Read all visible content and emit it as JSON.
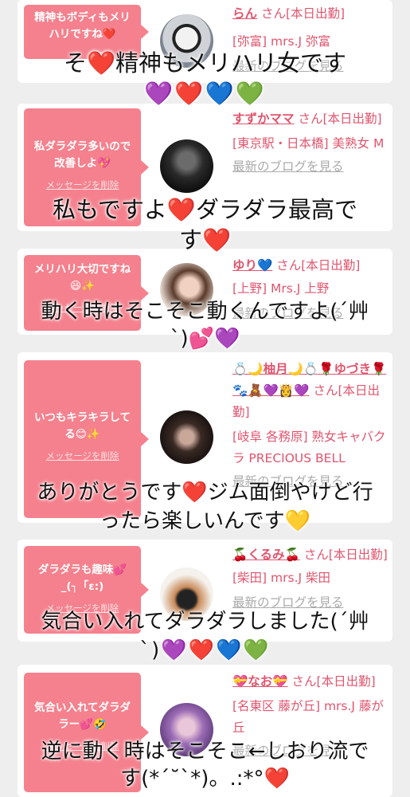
{
  "delete_label": "メッセージを削除",
  "blog_label": "最新のブログを見る",
  "cards": [
    {
      "message": "精神もボディもメリハリですね❤️",
      "name": "らん",
      "san": "さん[本日出勤]",
      "location": "[弥富] mrs.J 弥富",
      "overlay_line1": "そ❤️精神もメリハリ女です",
      "overlay_line2": "💜❤️💙💚"
    },
    {
      "message": "私ダラダラ多いので改善しよ💖",
      "name": "すずかママ",
      "san": "さん[本日出勤]",
      "location": "[東京駅・日本橋] 美熟女 M",
      "overlay_line1": "私もですよ❤️ダラダラ最高で",
      "overlay_line2": "す❤️"
    },
    {
      "message": "メリハリ大切ですね😆✨",
      "name": "ゆり💙",
      "san": "さん[本日出勤]",
      "location": "[上野] Mrs.J 上野",
      "overlay_line1": "動く時はそこそこ動くんですよ(´艸",
      "overlay_line2": "`)💕💜"
    },
    {
      "message": "いつもキラキラしてる😊✨",
      "name": "💍🌙柚月🌙💍🌹ゆづき🌹🐾🧸💜👸💜",
      "san": "さん[本日出勤]",
      "location": "[岐阜 各務原] 熟女キャバクラ PRECIOUS BELL",
      "overlay_line1": "ありがとうです❤️ジム面倒やけど行",
      "overlay_line2": "ったら楽しいんです💛"
    },
    {
      "message": "ダラダラも趣味💕_(┐「ε:)",
      "name": "🍒くるみ🍒",
      "san": "さん[本日出勤]",
      "location": "[柴田] mrs.J 柴田",
      "overlay_line1": "気合い入れてダラダラしました(´艸",
      "overlay_line2": "`)💜❤️💙💚"
    },
    {
      "message": "気合い入れてダラダラー💕🤣",
      "name": "💝なお💝",
      "san": "さん[本日出勤]",
      "location": "[名東区 藤が丘] mrs.J 藤が丘",
      "overlay_line1": "逆に動く時はそこそこ←しおり流で",
      "overlay_line2": "す(*´˘`*)。.:*°❤️"
    }
  ]
}
